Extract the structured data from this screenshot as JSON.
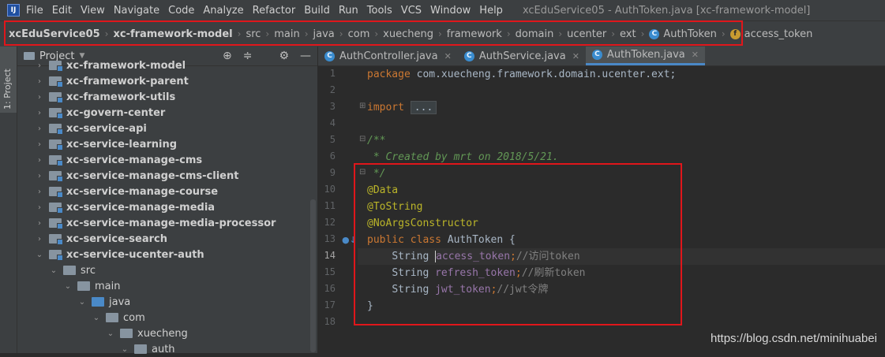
{
  "menu": {
    "items": [
      "File",
      "Edit",
      "View",
      "Navigate",
      "Code",
      "Analyze",
      "Refactor",
      "Build",
      "Run",
      "Tools",
      "VCS",
      "Window",
      "Help"
    ],
    "window_title": "xcEduService05 - AuthToken.java [xc-framework-model]"
  },
  "breadcrumb": {
    "items": [
      "xcEduService05",
      "xc-framework-model",
      "src",
      "main",
      "java",
      "com",
      "xuecheng",
      "framework",
      "domain",
      "ucenter",
      "ext",
      "AuthToken",
      "access_token"
    ]
  },
  "left_strip": {
    "label": "1: Project"
  },
  "project_panel": {
    "title": "Project",
    "tree": [
      {
        "label": "xc-framework-model",
        "depth": 1,
        "expanded": false,
        "bold": true,
        "icon": "module"
      },
      {
        "label": "xc-framework-parent",
        "depth": 1,
        "expanded": false,
        "bold": true,
        "icon": "module"
      },
      {
        "label": "xc-framework-utils",
        "depth": 1,
        "expanded": false,
        "bold": true,
        "icon": "module"
      },
      {
        "label": "xc-govern-center",
        "depth": 1,
        "expanded": false,
        "bold": true,
        "icon": "module"
      },
      {
        "label": "xc-service-api",
        "depth": 1,
        "expanded": false,
        "bold": true,
        "icon": "module"
      },
      {
        "label": "xc-service-learning",
        "depth": 1,
        "expanded": false,
        "bold": true,
        "icon": "module"
      },
      {
        "label": "xc-service-manage-cms",
        "depth": 1,
        "expanded": false,
        "bold": true,
        "icon": "module"
      },
      {
        "label": "xc-service-manage-cms-client",
        "depth": 1,
        "expanded": false,
        "bold": true,
        "icon": "module"
      },
      {
        "label": "xc-service-manage-course",
        "depth": 1,
        "expanded": false,
        "bold": true,
        "icon": "module"
      },
      {
        "label": "xc-service-manage-media",
        "depth": 1,
        "expanded": false,
        "bold": true,
        "icon": "module"
      },
      {
        "label": "xc-service-manage-media-processor",
        "depth": 1,
        "expanded": false,
        "bold": true,
        "icon": "module"
      },
      {
        "label": "xc-service-search",
        "depth": 1,
        "expanded": false,
        "bold": true,
        "icon": "module"
      },
      {
        "label": "xc-service-ucenter-auth",
        "depth": 1,
        "expanded": true,
        "bold": true,
        "icon": "module"
      },
      {
        "label": "src",
        "depth": 2,
        "expanded": true,
        "bold": false,
        "icon": "folder"
      },
      {
        "label": "main",
        "depth": 3,
        "expanded": true,
        "bold": false,
        "icon": "folder"
      },
      {
        "label": "java",
        "depth": 4,
        "expanded": true,
        "bold": false,
        "icon": "source"
      },
      {
        "label": "com",
        "depth": 5,
        "expanded": true,
        "bold": false,
        "icon": "package"
      },
      {
        "label": "xuecheng",
        "depth": 6,
        "expanded": true,
        "bold": false,
        "icon": "package"
      },
      {
        "label": "auth",
        "depth": 7,
        "expanded": true,
        "bold": false,
        "icon": "package"
      }
    ]
  },
  "editor": {
    "tabs": [
      {
        "label": "AuthController.java",
        "active": false
      },
      {
        "label": "AuthService.java",
        "active": false
      },
      {
        "label": "AuthToken.java",
        "active": true
      }
    ],
    "fold_chip": "...",
    "code": {
      "l1_kw": "package",
      "l1_rest": " com.xuecheng.framework.domain.ucenter.ext;",
      "l3_kw": "import",
      "l5": "/**",
      "l6": " * Created by mrt on 2018/5/21.",
      "l7": " */",
      "l8": "@Data",
      "l9": "@ToString",
      "l10": "@NoArgsConstructor",
      "l11_kw1": "public",
      "l11_kw2": "class",
      "l11_name": "AuthToken {",
      "l12_type": "String",
      "l12_field": "access_token",
      "l12_cmt": "//访问token",
      "l13_type": "String",
      "l13_field": "refresh_token",
      "l13_cmt": "//刷新token",
      "l14_type": "String",
      "l14_field": "jwt_token",
      "l14_cmt": "//jwt令牌",
      "l15": "}",
      "semi": ";"
    },
    "line_numbers": [
      "1",
      "2",
      "3",
      "4",
      "5",
      "6",
      "9",
      "10",
      "11",
      "12",
      "13",
      "14",
      "15",
      "16",
      "17",
      "18"
    ]
  },
  "watermark": "https://blog.csdn.net/minihuabei"
}
